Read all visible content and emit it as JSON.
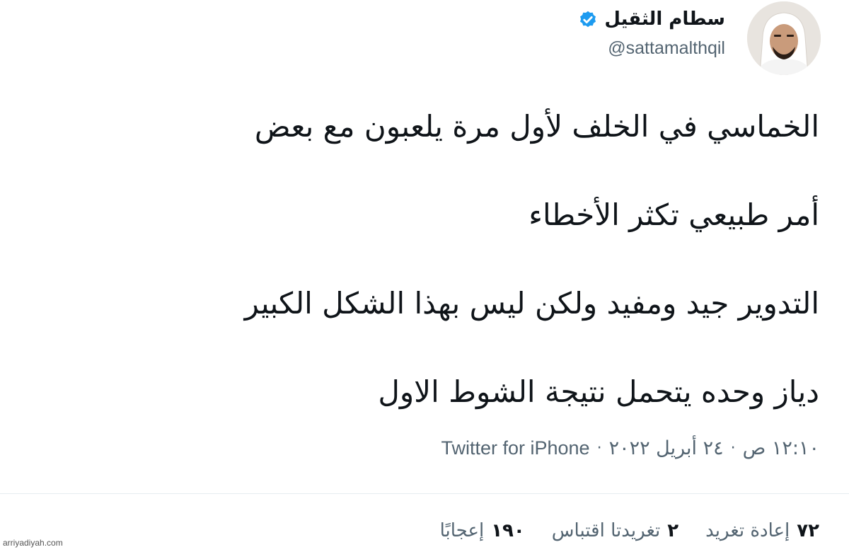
{
  "author": {
    "display_name": "سطام الثقيل",
    "handle": "@sattamalthqil",
    "verified": true,
    "verified_color": "#1d9bf0"
  },
  "tweet": {
    "lines": [
      "الخماسي في الخلف لأول مرة يلعبون مع بعض",
      "أمر طبيعي تكثر الأخطاء",
      "التدوير جيد ومفيد ولكن ليس بهذا الشكل الكبير",
      "دياز وحده يتحمل نتيجة الشوط الاول"
    ]
  },
  "meta": {
    "time": "١٢:١٠ ص",
    "separator": "·",
    "date": "٢٤ أبريل ٢٠٢٢",
    "source": "Twitter for iPhone"
  },
  "stats": {
    "retweets_count": "٧٢",
    "retweets_label": "إعادة تغريد",
    "quotes_count": "٢",
    "quotes_label": "تغريدتا اقتباس",
    "likes_count": "١٩٠",
    "likes_label": "إعجابًا"
  },
  "watermark": "arriyadiyah.com",
  "icons": {
    "verified": "verified-badge-icon",
    "avatar": "profile-avatar"
  }
}
